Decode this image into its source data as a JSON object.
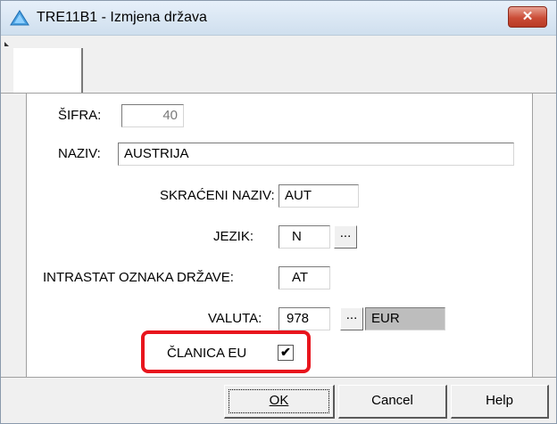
{
  "window": {
    "title": "TRE11B1 - Izmjena država",
    "close_label": "✕"
  },
  "form": {
    "sifra_label": "ŠIFRA:",
    "sifra_value": "40",
    "naziv_label": "NAZIV:",
    "naziv_value": "AUSTRIJA",
    "skraceni_label": "SKRAĆENI NAZIV:",
    "skraceni_value": "AUT",
    "jezik_label": "JEZIK:",
    "jezik_value": "N",
    "jezik_lookup": "...",
    "intrastat_label": "INTRASTAT OZNAKA DRŽAVE:",
    "intrastat_value": "AT",
    "valuta_label": "VALUTA:",
    "valuta_value": "978",
    "valuta_lookup": "...",
    "valuta_name": "EUR",
    "clanica_label": "ČLANICA EU",
    "clanica_checked": true,
    "check_glyph": "✔"
  },
  "buttons": {
    "ok": "OK",
    "cancel": "Cancel",
    "help": "Help"
  },
  "colors": {
    "highlight": "#e8151d",
    "close_button": "#cb4d37"
  }
}
